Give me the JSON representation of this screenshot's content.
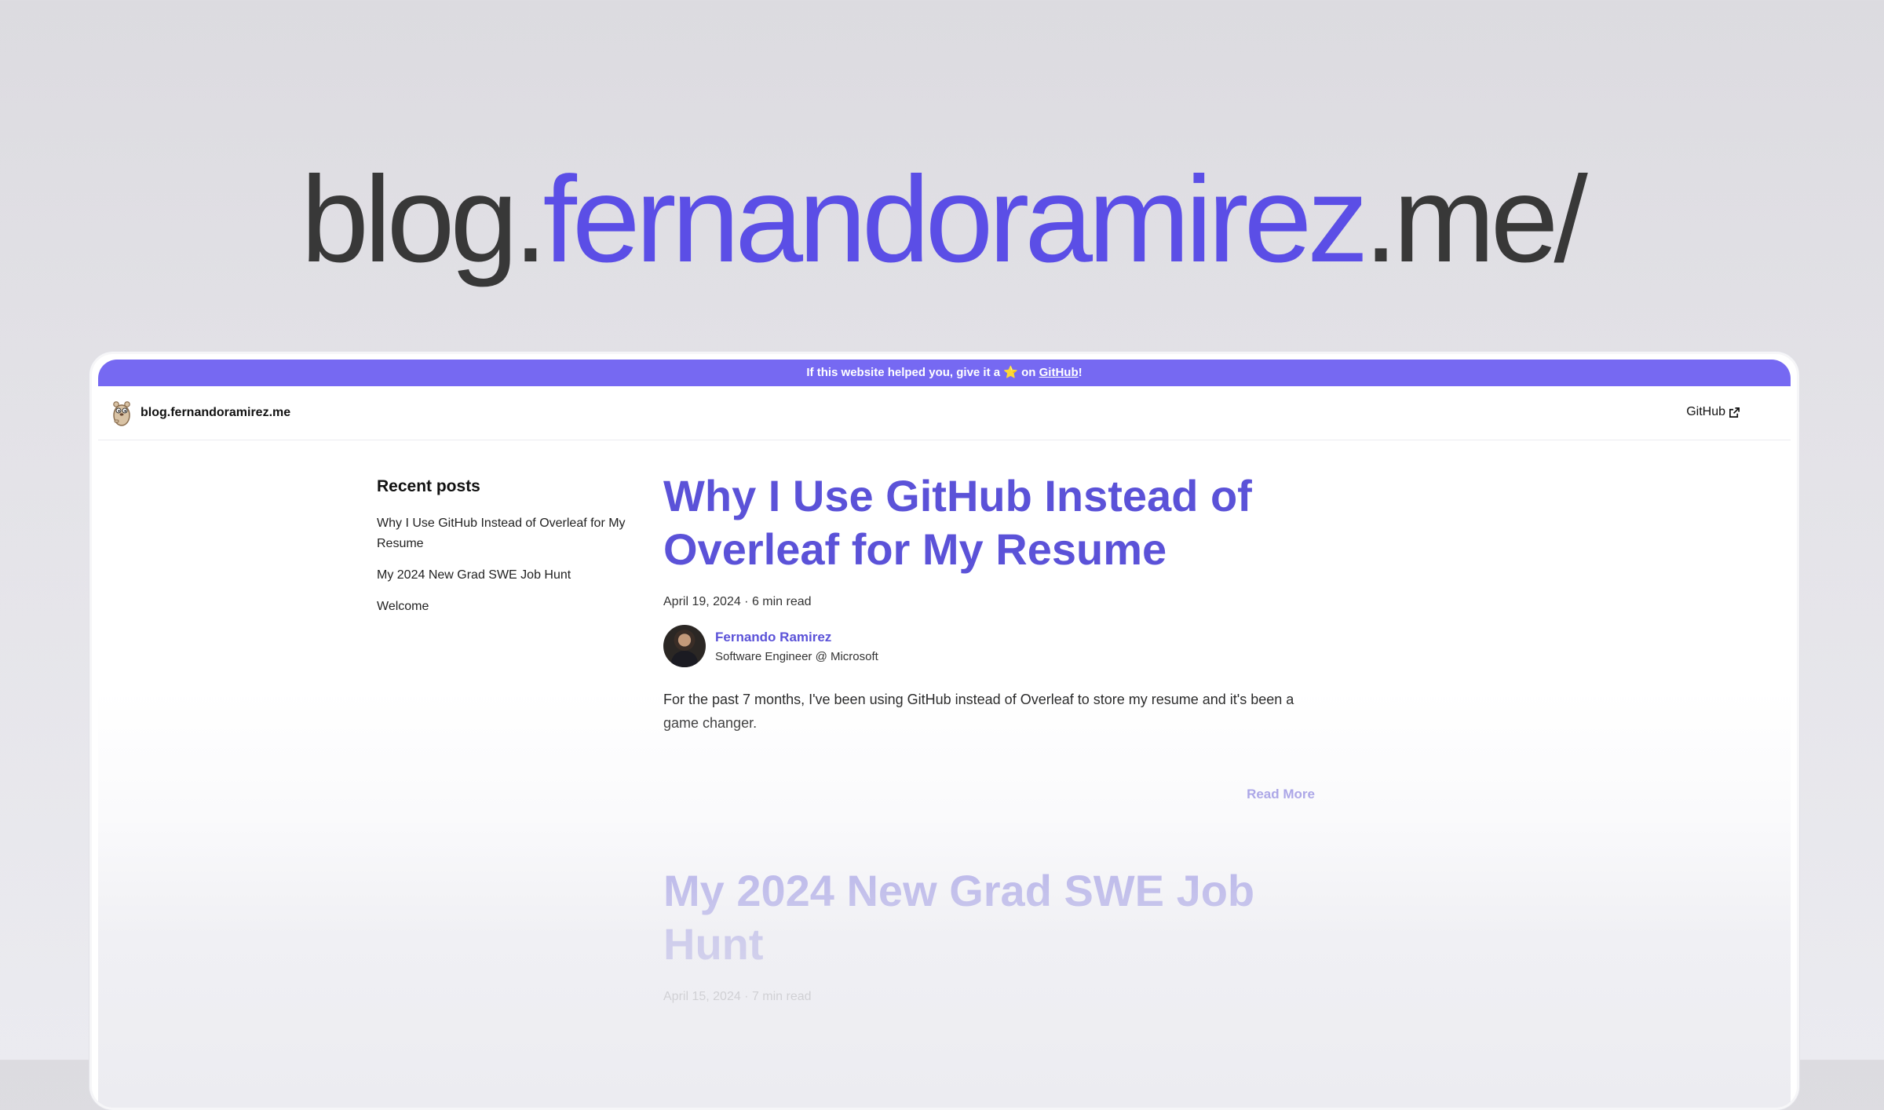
{
  "hero": {
    "prefix": "blog.",
    "accent": "fernandoramirez",
    "suffix": ".me/"
  },
  "banner": {
    "text_before": "If this website helped you, give it a",
    "star": "⭐",
    "text_on": "on",
    "link": "GitHub",
    "text_after": "!"
  },
  "navbar": {
    "brand": "blog.fernandoramirez.me",
    "logo_icon": "gopher-icon",
    "github": "GitHub",
    "external_icon": "external-link-icon"
  },
  "sidebar": {
    "heading": "Recent posts",
    "posts": [
      "Why I Use GitHub Instead of Overleaf for My Resume",
      "My 2024 New Grad SWE Job Hunt",
      "Welcome"
    ]
  },
  "post1": {
    "title": "Why I Use GitHub Instead of Overleaf for My Resume",
    "meta": "April 19, 2024 · 6 min read",
    "author": "Fernando Ramirez",
    "role": "Software Engineer @ Microsoft",
    "excerpt": "For the past 7 months, I've been using GitHub instead of Overleaf to store my resume and it's been a game changer.",
    "read_more": "Read More"
  },
  "post2": {
    "title": "My 2024 New Grad SWE Job Hunt",
    "meta": "April 15, 2024 · 7 min read"
  },
  "colors": {
    "accent": "#5b4ee6",
    "banner": "#7669f2",
    "title": "#5b52d8"
  }
}
